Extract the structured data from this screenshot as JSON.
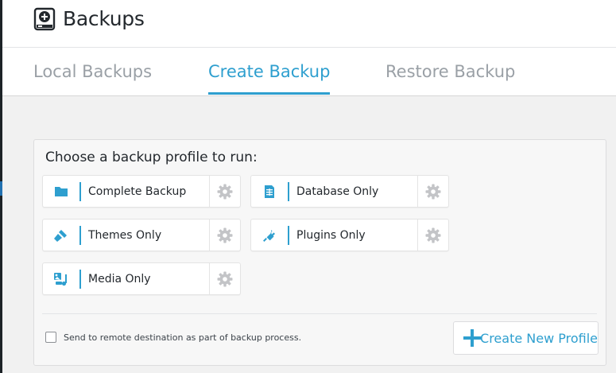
{
  "header": {
    "title": "Backups",
    "icon": "backup-drive-icon"
  },
  "tabs": [
    {
      "label": "Local Backups",
      "active": false
    },
    {
      "label": "Create Backup",
      "active": true
    },
    {
      "label": "Restore Backup",
      "active": false
    }
  ],
  "panel": {
    "title": "Choose a backup profile to run:",
    "profiles": [
      {
        "label": "Complete Backup",
        "icon": "folder-icon"
      },
      {
        "label": "Database Only",
        "icon": "database-document-icon"
      },
      {
        "label": "Themes Only",
        "icon": "paintbrush-icon"
      },
      {
        "label": "Plugins Only",
        "icon": "plugin-icon"
      },
      {
        "label": "Media Only",
        "icon": "media-icon"
      }
    ],
    "remote_option": {
      "label": "Send to remote destination as part of backup process.",
      "checked": false
    },
    "create_button": {
      "label": "Create New Profile"
    }
  },
  "colors": {
    "accent": "#2e9fcf",
    "icon_gray": "#c3c4c7",
    "text": "#23282d"
  }
}
